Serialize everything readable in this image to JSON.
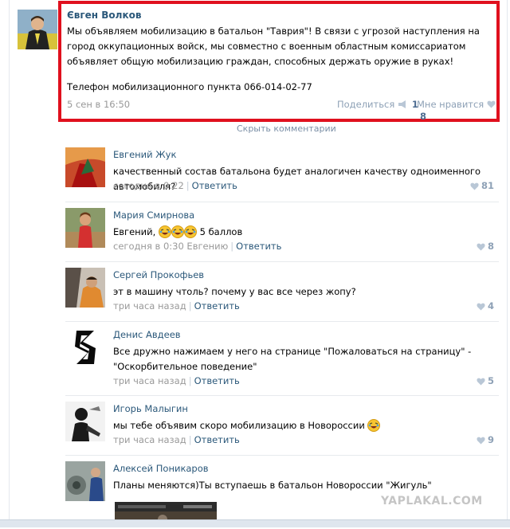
{
  "post": {
    "author": "Євген Волков",
    "text": "Мы объявляем мобилизацию в батальон \"Таврия\"! В связи с угрозой наступления на город оккупационных войск, мы совместно с военным областным комиссариатом объявляет общую мобилизацию граждан, способных держать оружие в руках!",
    "phone": "Телефон мобилизационного пункта 066-014-02-77",
    "date": "5 сен в 16:50",
    "share_label": "Поделиться",
    "share_count": "1",
    "like_label": "Мне нравится",
    "like_count": "8",
    "highlight_color": "#e0101e"
  },
  "hide_comments": "Скрыть комментарии",
  "comments": [
    {
      "author": "Евгений Жук",
      "text": "качественный состав батальона будет аналогичен качеству одноименного автомобиля?",
      "time": "сегодня в 0:22",
      "reply": "Ответить",
      "likes": "81"
    },
    {
      "author": "Мария Смирнова",
      "text_before": "Евгений,",
      "text_after": "5 баллов",
      "time": "сегодня в 0:30 Евгению",
      "reply": "Ответить",
      "likes": "8"
    },
    {
      "author": "Сергей Прокофьев",
      "text": "эт в машину чтоль? почему у вас все через жопу?",
      "time": "три часа назад",
      "reply": "Ответить",
      "likes": "4"
    },
    {
      "author": "Денис Авдеев",
      "text": "Все дружно нажимаем у него на странице \"Пожаловаться на страницу\" - \"Оскорбительное поведение\"",
      "time": "три часа назад",
      "reply": "Ответить",
      "likes": "5"
    },
    {
      "author": "Игорь Малыгин",
      "text": "мы тебе объявим скоро мобилизацию в Новороссии",
      "time": "три часа назад",
      "reply": "Ответить",
      "likes": "9"
    },
    {
      "author": "Алексей Поникаров",
      "text": "Планы меняются)Ты вступаешь в батальон Новороссии \"Жигуль\""
    }
  ],
  "watermark": "YAPLAKAL.COM"
}
